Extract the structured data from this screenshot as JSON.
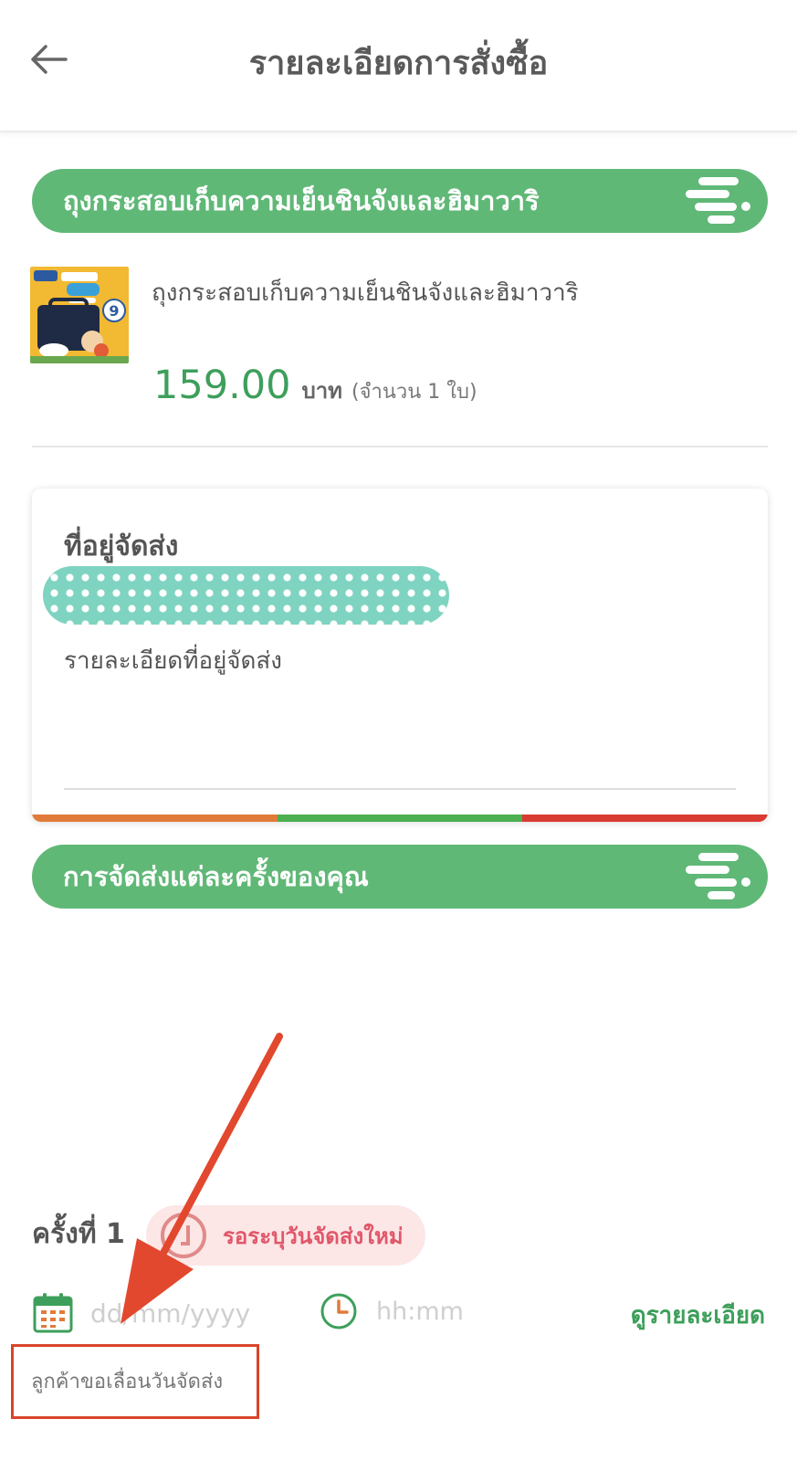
{
  "header": {
    "title": "รายละเอียดการสั่งซื้อ"
  },
  "product_section": {
    "title": "ถุงกระสอบเก็บความเย็นชินจังและฮิมาวาริ"
  },
  "product": {
    "name": "ถุงกระสอบเก็บความเย็นชินจังและฮิมาวาริ",
    "price": "159.00",
    "currency": "บาท",
    "quantity_text": "(จำนวน 1 ใบ)"
  },
  "address": {
    "heading": "ที่อยู่จัดส่ง",
    "detail_label": "รายละเอียดที่อยู่จัดส่ง"
  },
  "delivery_section": {
    "title": "การจัดส่งแต่ละครั้งของคุณ"
  },
  "delivery": {
    "round_label": "ครั้งที่ 1",
    "status": "รอระบุวันจัดส่งใหม่",
    "date_placeholder": "dd/mm/yyyy",
    "time_placeholder": "hh:mm",
    "view_detail": "ดูรายละเอียด",
    "note": "ลูกค้าขอเลื่อนวันจัดส่ง"
  },
  "icons": {
    "back": "arrow-left-icon",
    "calendar": "calendar-icon",
    "clock": "clock-icon",
    "status": "clock-outline-icon",
    "banner": "speed-lines-icon"
  },
  "colors": {
    "brand_green": "#60b877",
    "price_green": "#3d9f5b",
    "status_bg": "#fce6e6",
    "status_text": "#e0576a",
    "bar_orange": "#e07b39",
    "bar_green": "#4caf50",
    "bar_red": "#d93a32",
    "annotation_red": "#d9442a"
  }
}
